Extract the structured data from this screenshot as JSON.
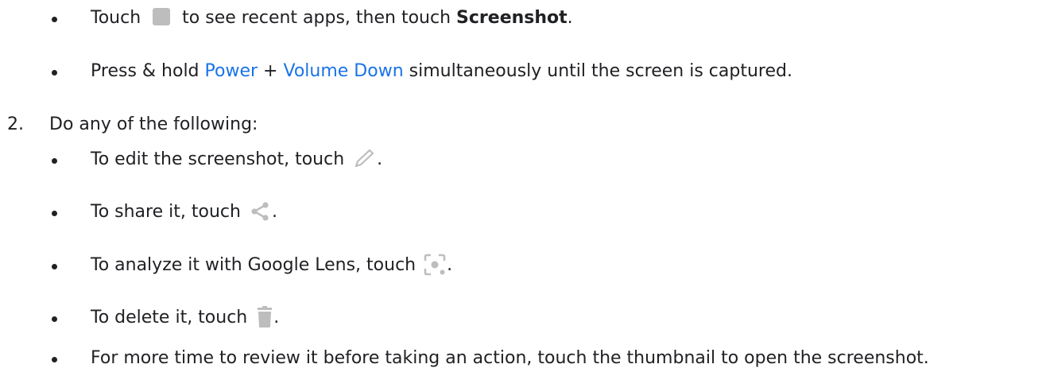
{
  "step1_bullets": {
    "recent_apps": {
      "prefix": "Touch",
      "icon": "square-recents-icon",
      "middle": "to see recent apps, then touch",
      "bold": "Screenshot",
      "suffix": "."
    },
    "power_volume": {
      "prefix": "Press & hold",
      "link1": "Power",
      "plus": "+",
      "link2": "Volume Down",
      "suffix": "simultaneously until the screen is captured."
    }
  },
  "step2": {
    "number": "2.",
    "text": "Do any of the following:",
    "bullets": {
      "edit": {
        "text": "To edit the screenshot, touch",
        "icon": "pencil-icon",
        "suffix": "."
      },
      "share": {
        "text": "To share it, touch",
        "icon": "share-icon",
        "suffix": "."
      },
      "lens": {
        "text": "To analyze it with Google Lens, touch",
        "icon": "google-lens-icon",
        "suffix": "."
      },
      "delete": {
        "text": "To delete it, touch",
        "icon": "trash-icon",
        "suffix": "."
      },
      "review": {
        "text": "For more time to review it before taking an action, touch the thumbnail to open the screenshot."
      }
    }
  },
  "colors": {
    "text": "#202124",
    "link": "#1a73e8",
    "icon_gray": "#bdbdbd"
  }
}
